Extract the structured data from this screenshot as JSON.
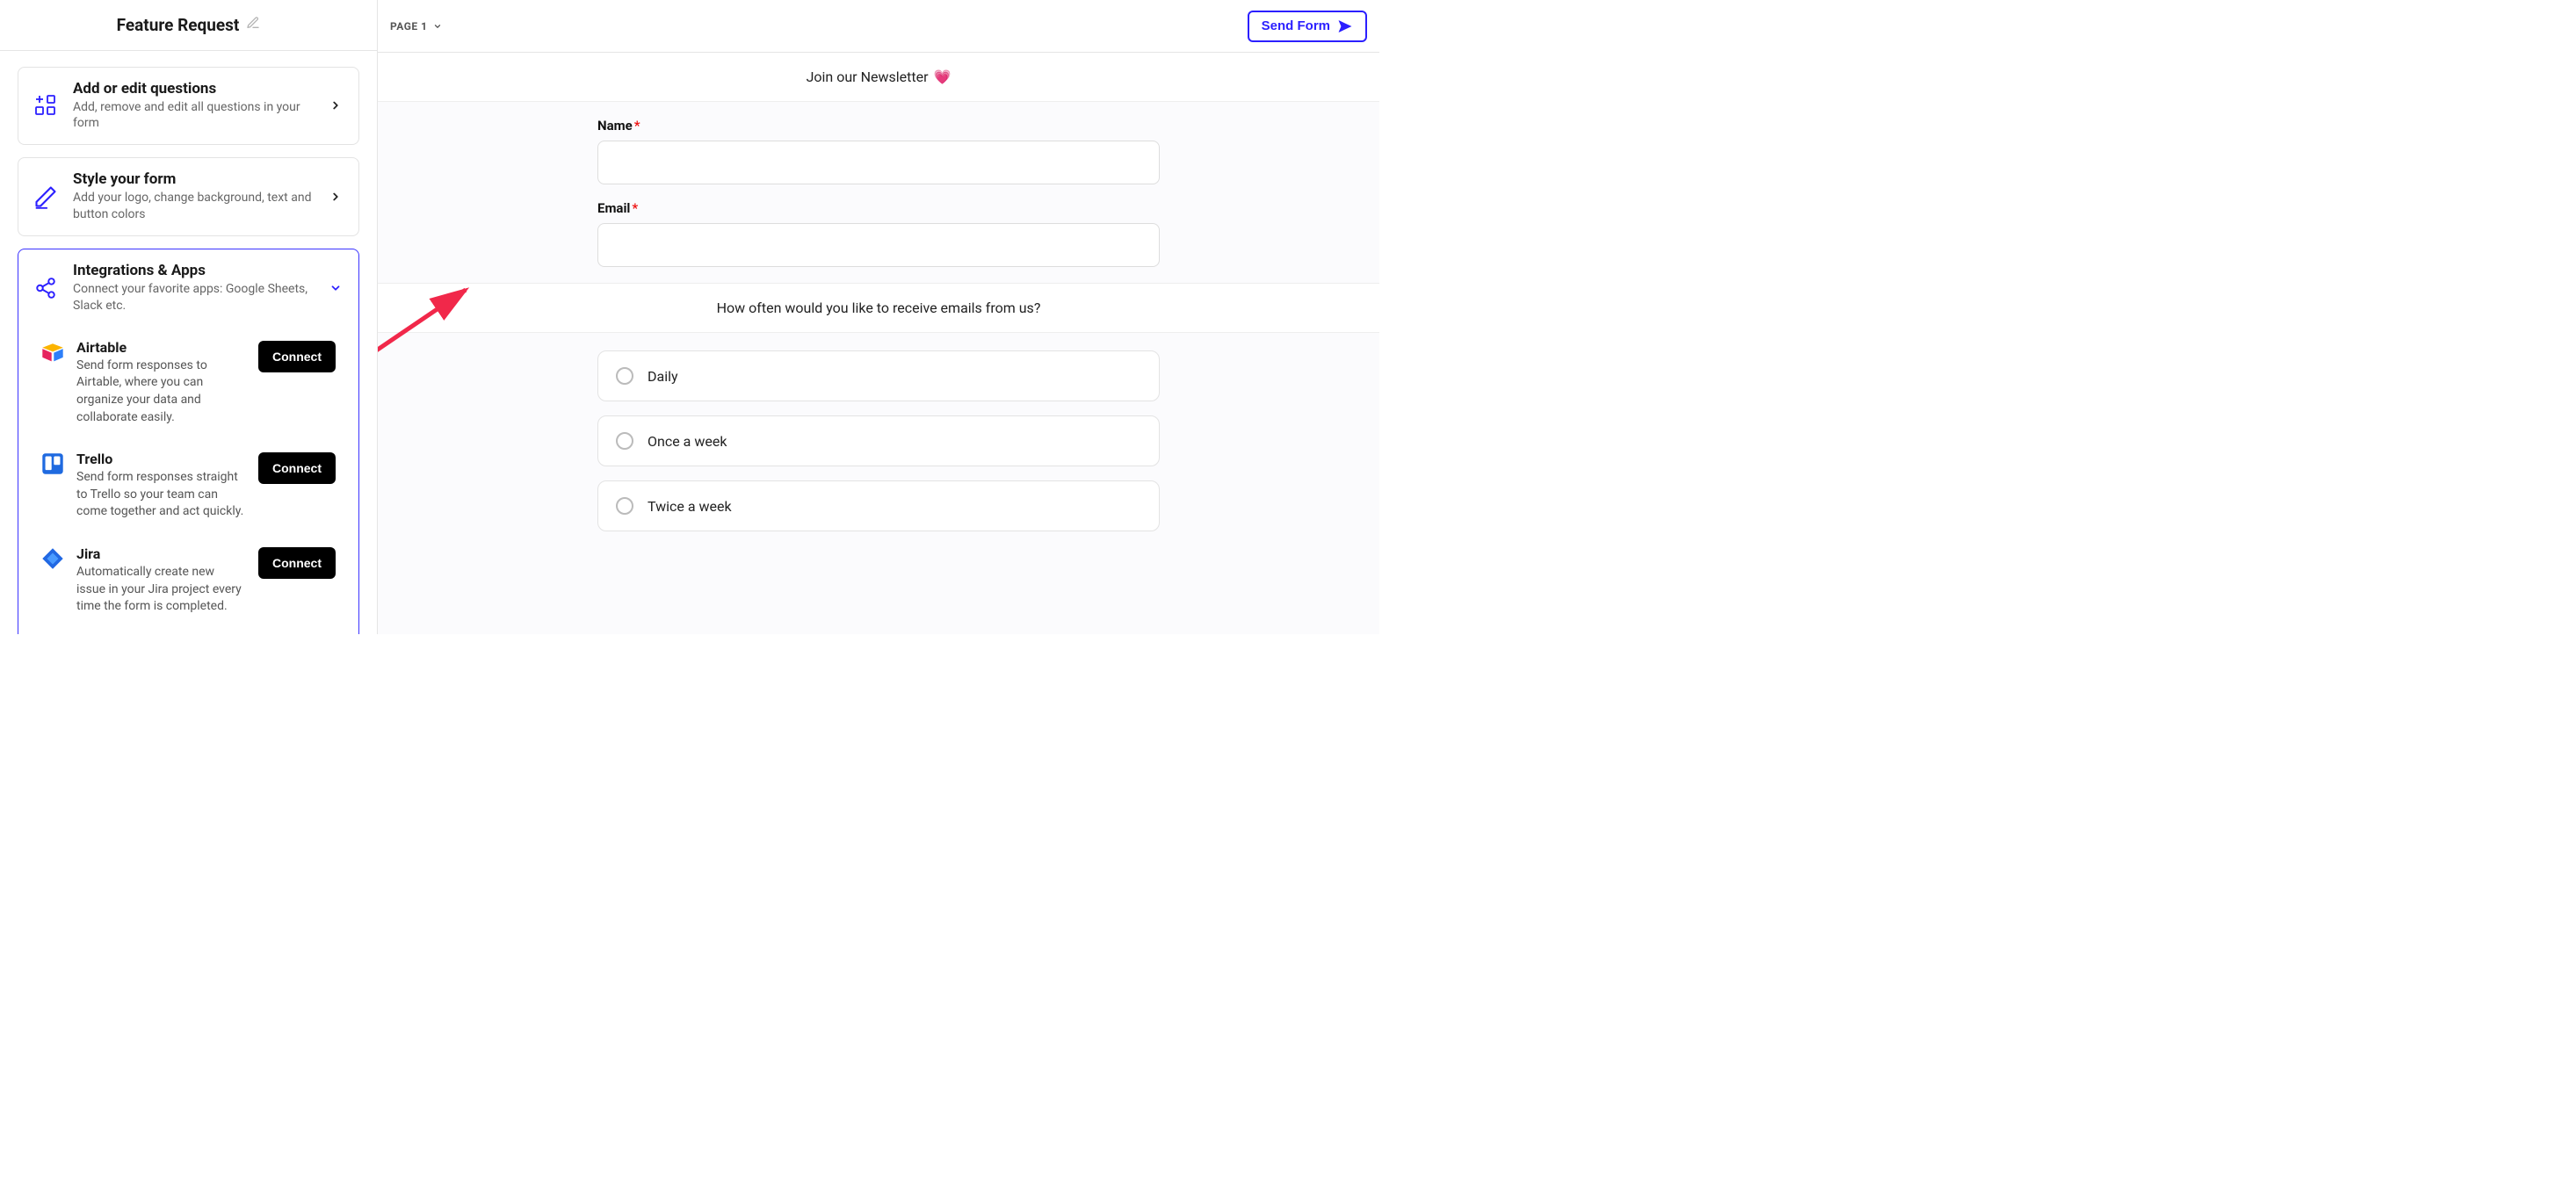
{
  "left": {
    "title": "Feature Request",
    "cards": {
      "questions": {
        "title": "Add or edit questions",
        "sub": "Add, remove and edit all questions in your form"
      },
      "style": {
        "title": "Style your form",
        "sub": "Add your logo, change background, text and button colors"
      },
      "integrations": {
        "title": "Integrations & Apps",
        "sub": "Connect your favorite apps: Google Sheets, Slack etc."
      }
    },
    "integrations": [
      {
        "name": "Airtable",
        "desc": "Send form responses to Airtable, where you can organize your data and collaborate easily.",
        "action": "Connect"
      },
      {
        "name": "Trello",
        "desc": "Send form responses straight to Trello so your team can come together and act quickly.",
        "action": "Connect"
      },
      {
        "name": "Jira",
        "desc": "Automatically create new issue in your Jira project every time the form is completed.",
        "action": "Connect"
      }
    ]
  },
  "right": {
    "page_label": "PAGE 1",
    "send_label": "Send Form",
    "intro_title": "Join our Newsletter ",
    "name_label": "Name",
    "email_label": "Email",
    "frequency_question": "How often would you like to receive emails from us?",
    "options": [
      "Daily",
      "Once a week",
      "Twice a week"
    ]
  }
}
